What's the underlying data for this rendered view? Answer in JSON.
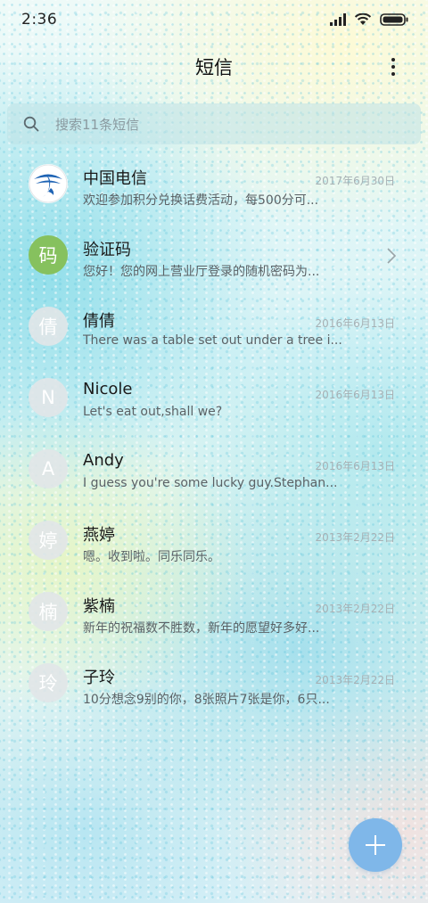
{
  "status_bar": {
    "time": "2:36"
  },
  "header": {
    "title": "短信"
  },
  "search": {
    "placeholder": "搜索11条短信"
  },
  "conversations": [
    {
      "name": "中国电信",
      "preview": "欢迎参加积分兑换话费活动，每500分可...",
      "date": "2017年6月30日",
      "avatar_icon": "china-telecom-logo"
    },
    {
      "name": "验证码",
      "preview": "您好！您的网上营业厅登录的随机密码为...",
      "avatar_text": "码",
      "avatar_color": "#86c15e"
    },
    {
      "name": "倩倩",
      "preview": "There was a table set out under a tree i...",
      "date": "2016年6月13日",
      "avatar_text": "倩"
    },
    {
      "name": "Nicole",
      "preview": "Let's eat out,shall we?",
      "date": "2016年6月13日",
      "avatar_text": "N"
    },
    {
      "name": "Andy",
      "preview": "I guess you're some lucky guy.Stephan...",
      "date": "2016年6月13日",
      "avatar_text": "A"
    },
    {
      "name": "燕婷",
      "preview": "嗯。收到啦。同乐同乐。",
      "date": "2013年2月22日",
      "avatar_text": "婷"
    },
    {
      "name": "紫楠",
      "preview": "新年的祝福数不胜数，新年的愿望好多好...",
      "date": "2013年2月22日",
      "avatar_text": "楠"
    },
    {
      "name": "子玲",
      "preview": "10分想念9别的你，8张照片7张是你，6只...",
      "date": "2013年2月22日",
      "avatar_text": "玲"
    }
  ],
  "colors": {
    "fab": "#7fb7e9",
    "accent_green": "#86c15e",
    "telecom_blue": "#1e63b4"
  },
  "fab": {
    "icon": "plus-icon"
  }
}
